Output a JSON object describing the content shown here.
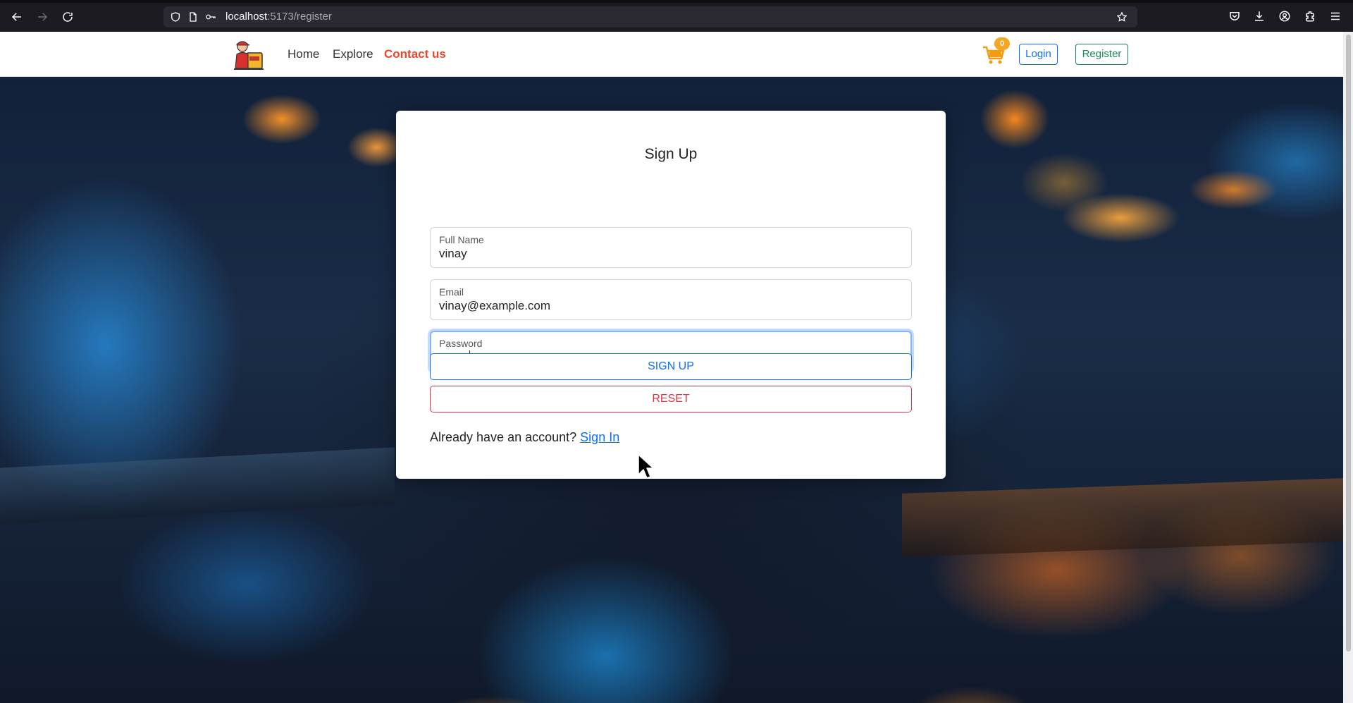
{
  "browser": {
    "url_host": "localhost",
    "url_path": ":5173/register"
  },
  "navbar": {
    "links": [
      {
        "label": "Home"
      },
      {
        "label": "Explore"
      },
      {
        "label": "Contact us"
      }
    ],
    "cart_count": "0",
    "login_label": "Login",
    "register_label": "Register"
  },
  "form": {
    "title": "Sign Up",
    "full_name": {
      "label": "Full Name",
      "value": "vinay"
    },
    "email": {
      "label": "Email",
      "value": "vinay@example.com"
    },
    "password": {
      "label": "Password",
      "value": "••••••"
    },
    "signup_label": "SIGN UP",
    "reset_label": "RESET",
    "account_prompt": "Already have an account?",
    "signin_link": "Sign In"
  },
  "colors": {
    "primary": "#0d6efd",
    "danger": "#dc3545",
    "success": "#198754",
    "brand_accent": "#e8472b",
    "badge": "#f5a623"
  }
}
